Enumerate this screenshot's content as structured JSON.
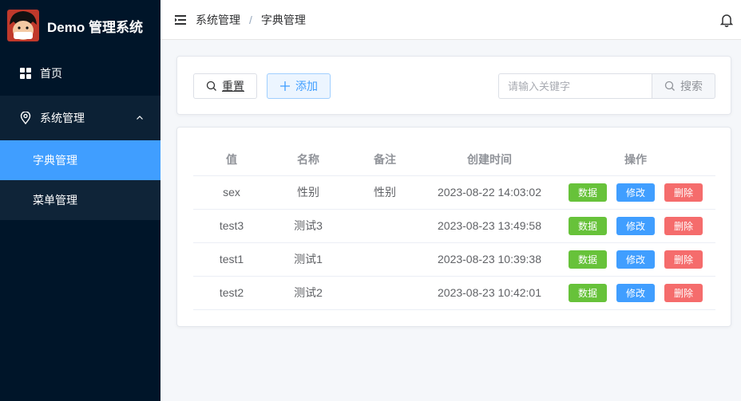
{
  "brand": {
    "title": "Demo 管理系统"
  },
  "sidebar": {
    "items": [
      {
        "label": "首页",
        "icon": "grid-icon"
      },
      {
        "label": "系统管理",
        "icon": "location-pin-icon",
        "expanded": true,
        "children": [
          {
            "label": "字典管理",
            "active": true
          },
          {
            "label": "菜单管理",
            "active": false
          }
        ]
      }
    ]
  },
  "breadcrumb": {
    "items": [
      "系统管理",
      "字典管理"
    ],
    "separator": "/"
  },
  "toolbar": {
    "reset_label": "重置",
    "add_label": "添加",
    "search_placeholder": "请输入关键字",
    "search_value": "",
    "search_label": "搜索"
  },
  "table": {
    "headers": [
      "值",
      "名称",
      "备注",
      "创建时间",
      "操作"
    ],
    "rows": [
      {
        "value": "sex",
        "name": "性别",
        "note": "性别",
        "created": "2023-08-22 14:03:02"
      },
      {
        "value": "test3",
        "name": "测试3",
        "note": "",
        "created": "2023-08-23 13:49:58"
      },
      {
        "value": "test1",
        "name": "测试1",
        "note": "",
        "created": "2023-08-23 10:39:38"
      },
      {
        "value": "test2",
        "name": "测试2",
        "note": "",
        "created": "2023-08-23 10:42:01"
      }
    ],
    "actions": {
      "data": "数据",
      "edit": "修改",
      "delete": "删除"
    }
  },
  "colors": {
    "sidebar_bg": "#001529",
    "active_menu": "#409eff",
    "data_button": "#67c23a",
    "edit_button": "#409eff",
    "delete_button": "#f56c6c"
  }
}
